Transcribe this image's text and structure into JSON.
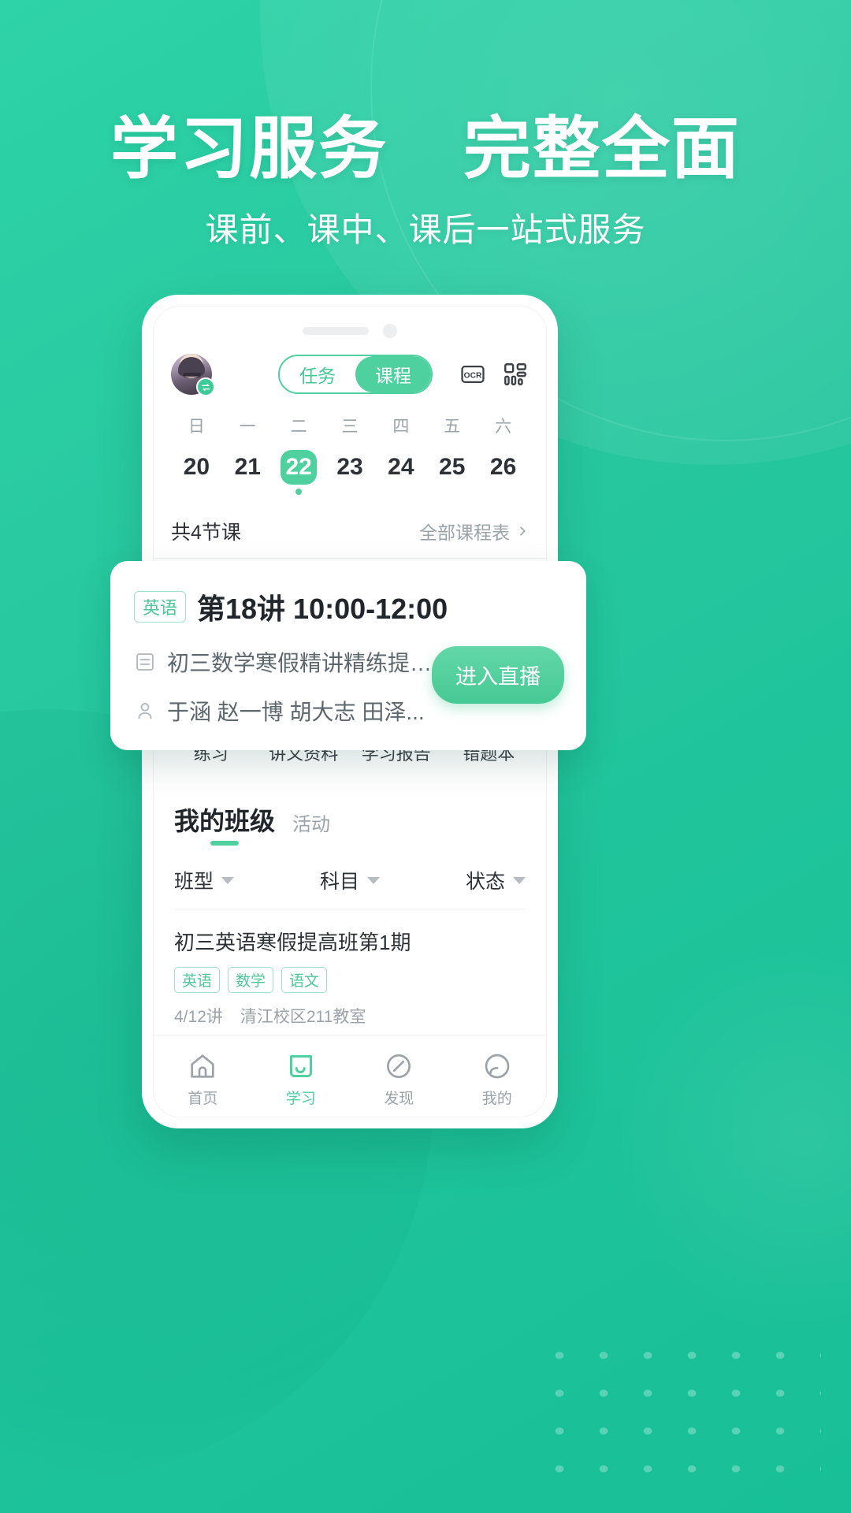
{
  "promo": {
    "headline_left": "学习服务",
    "headline_right": "完整全面",
    "subhead": "课前、课中、课后一站式服务"
  },
  "colors": {
    "brand_green": "#2ed3a7",
    "accent_green": "#4ed09f",
    "badge_orange": "#ffa726",
    "text_dark": "#20262b",
    "text_muted": "#9aa3a9"
  },
  "app": {
    "header": {
      "avatar_icon": "user-avatar",
      "swap_badge_icon": "swap-icon",
      "segments": [
        {
          "label": "任务",
          "active": false
        },
        {
          "label": "课程",
          "active": true
        }
      ],
      "icons": [
        {
          "name": "ocr-icon",
          "label": "OCR"
        },
        {
          "name": "qrcode-icon",
          "label": "QR"
        }
      ]
    },
    "calendar": {
      "dow": [
        "日",
        "一",
        "二",
        "三",
        "四",
        "五",
        "六"
      ],
      "dates": [
        "20",
        "21",
        "22",
        "23",
        "24",
        "25",
        "26"
      ],
      "selected_index": 2,
      "dot_index": 2
    },
    "count_row": {
      "left": "共4节课",
      "right": "全部课程表",
      "chevron_icon": "chevron-right-icon"
    },
    "lesson_card": {
      "subject_badge": "英语",
      "title": "第18讲 10:00-12:00",
      "course_icon": "list-icon",
      "course_name": "初三数学寒假精讲精练提高班...",
      "teacher_icon": "person-icon",
      "teachers": "于涵  赵一博  胡大志  田泽...",
      "cta_label": "进入直播"
    },
    "quick_actions": [
      {
        "label": "练习",
        "icon": "pencil-note-icon",
        "badge": true
      },
      {
        "label": "讲义资料",
        "icon": "folder-star-icon",
        "badge": false
      },
      {
        "label": "学习报告",
        "icon": "bulb-report-icon",
        "badge": false
      },
      {
        "label": "错题本",
        "icon": "wrong-book-icon",
        "badge": false
      }
    ],
    "my_class": {
      "tab_main": "我的班级",
      "tab_sub": "活动",
      "filters": [
        {
          "label": "班型"
        },
        {
          "label": "科目"
        },
        {
          "label": "状态"
        }
      ],
      "items": [
        {
          "title": "初三英语寒假提高班第1期",
          "tags": [
            "英语",
            "数学",
            "语文"
          ],
          "meta_lessons": "4/12讲",
          "meta_room": "清江校区211教室"
        }
      ]
    },
    "tabbar": [
      {
        "label": "首页",
        "icon": "home-icon",
        "active": false
      },
      {
        "label": "学习",
        "icon": "book-icon",
        "active": true
      },
      {
        "label": "发现",
        "icon": "compass-icon",
        "active": false
      },
      {
        "label": "我的",
        "icon": "profile-icon",
        "active": false
      }
    ]
  }
}
